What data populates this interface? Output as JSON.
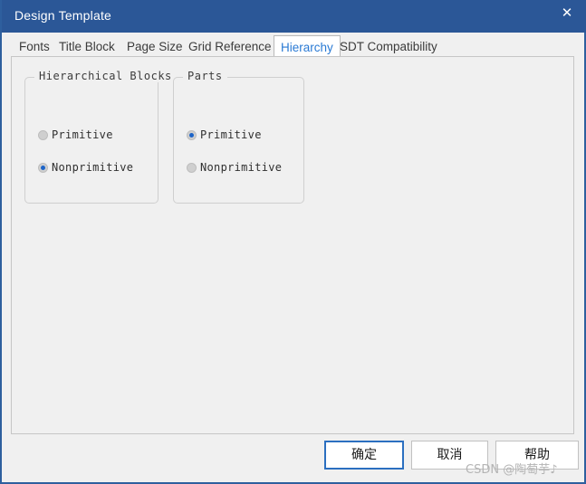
{
  "window": {
    "title": "Design Template",
    "close_icon": "close-icon",
    "close_glyph": "✕",
    "accent_color": "#2b5797",
    "body_color": "#f0f0f0"
  },
  "tabs": {
    "selected": "Hierarchy",
    "items": [
      {
        "label": "Fonts",
        "selected": false
      },
      {
        "label": "Title Block",
        "selected": false
      },
      {
        "label": "Page Size",
        "selected": false
      },
      {
        "label": "Grid Reference",
        "selected": false
      },
      {
        "label": "Hierarchy",
        "selected": true
      },
      {
        "label": "SDT Compatibility",
        "selected": false
      }
    ]
  },
  "content": {
    "groups": [
      {
        "title": "Hierarchical Blocks",
        "options": [
          {
            "label": "Primitive",
            "checked": false
          },
          {
            "label": "Nonprimitive",
            "checked": true
          }
        ]
      },
      {
        "title": "Parts",
        "options": [
          {
            "label": "Primitive",
            "checked": true
          },
          {
            "label": "Nonprimitive",
            "checked": false
          }
        ]
      }
    ]
  },
  "footer": {
    "ok_label": "确定",
    "cancel_label": "取消",
    "help_label": "帮助",
    "default_button_color": "#2b6fc0"
  },
  "watermark": {
    "text": "CSDN @陶萄芋♪"
  }
}
